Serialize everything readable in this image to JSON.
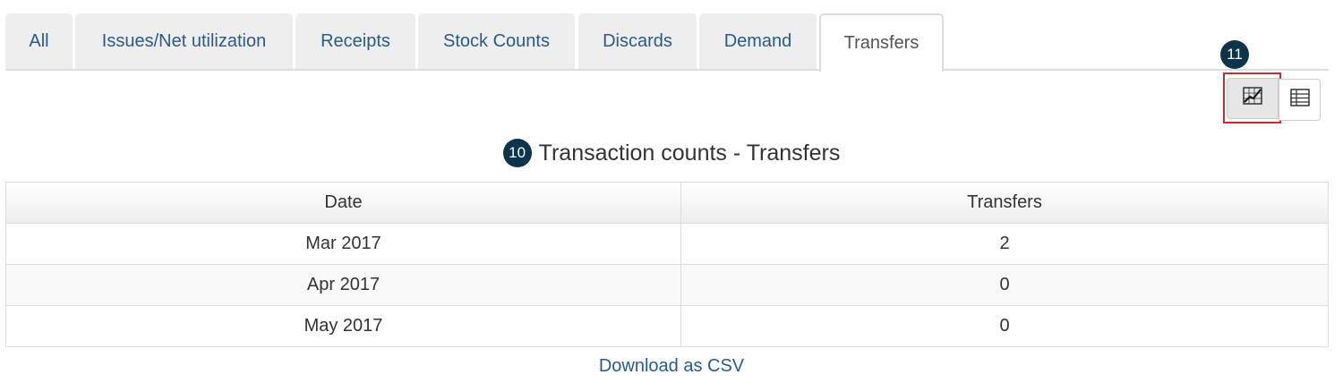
{
  "tabs": [
    {
      "label": "All"
    },
    {
      "label": "Issues/Net utilization"
    },
    {
      "label": "Receipts"
    },
    {
      "label": "Stock Counts"
    },
    {
      "label": "Discards"
    },
    {
      "label": "Demand"
    },
    {
      "label": "Transfers",
      "active": true
    }
  ],
  "badges": {
    "chart_toggle": "11",
    "title": "10"
  },
  "view_toggle": {
    "chart_icon": "chart-icon",
    "table_icon": "table-icon",
    "highlight_color": "#b5343a"
  },
  "title": "Transaction counts - Transfers",
  "table": {
    "headers": [
      "Date",
      "Transfers"
    ],
    "rows": [
      [
        "Mar 2017",
        "2"
      ],
      [
        "Apr 2017",
        "0"
      ],
      [
        "May 2017",
        "0"
      ]
    ]
  },
  "download_label": "Download as CSV",
  "colors": {
    "link": "#2a5a8c",
    "badge": "#0d3448",
    "tab_bg": "#eeeeee"
  }
}
